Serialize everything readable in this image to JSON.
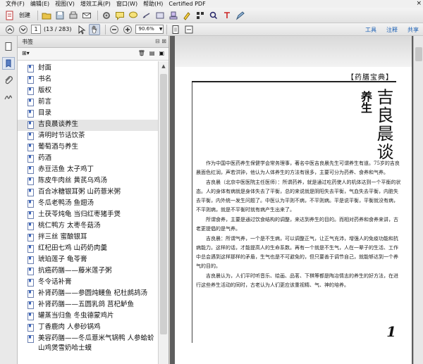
{
  "menu": [
    "文件(F)",
    "编辑(E)",
    "视图(V)",
    "增效工具(P)",
    "窗口(W)",
    "帮助(H)",
    "Certified PDF"
  ],
  "window_control": "×",
  "toolbar1": {
    "create_label": "创建",
    "icons": [
      "create-icon",
      "open-folder-icon",
      "print-icon",
      "save-icon",
      "email-icon",
      "settings-icon",
      "comment-icon",
      "chat-icon",
      "link-icon",
      "tag-icon",
      "stamp-icon",
      "highlight-icon",
      "qr-icon",
      "search-icon",
      "text-icon",
      "edit-icon"
    ]
  },
  "toolbar2": {
    "page_current": "1",
    "page_count": "(13 / 283)",
    "zoom": "90.6%",
    "links": [
      "工具",
      "注释",
      "共享"
    ]
  },
  "bookmarks_panel": {
    "title": "书签",
    "options_label": "⊞▾",
    "items": [
      {
        "label": "封面"
      },
      {
        "label": "书名"
      },
      {
        "label": "版权"
      },
      {
        "label": "前言"
      },
      {
        "label": "目录"
      },
      {
        "label": "吉良晨谈养生",
        "selected": true
      },
      {
        "label": "清明时节话饮茶"
      },
      {
        "label": "葡萄酒与养生"
      },
      {
        "label": "药酒"
      },
      {
        "label": "赤豆活鱼 太子鸡丁"
      },
      {
        "label": "陈皮牛肉丝 黄芪乌鸡汤"
      },
      {
        "label": "百合冰糖银耳粥 山药薏米粥"
      },
      {
        "label": "冬瓜老鸭汤 鱼翅汤"
      },
      {
        "label": "土茯苓炖龟 当归红枣猪手煲"
      },
      {
        "label": "桃仁鸭方 太枣冬菇汤"
      },
      {
        "label": "拌三丝 蜜酿银耳"
      },
      {
        "label": "红杞田七鸡 山药奶肉羹"
      },
      {
        "label": "琥珀莲子 龟苓膏"
      },
      {
        "label": "抗癌药膳——藤米莲子粥"
      },
      {
        "label": "冬令话补膏"
      },
      {
        "label": "补肾药膳——参圆炖鳗鱼 杞杜鹧鸪汤"
      },
      {
        "label": "补肾药膳——五圆乳鸽 莒杞鲈鱼"
      },
      {
        "label": "罐蒸当归鱼 冬虫德蒙鸡片"
      },
      {
        "label": "丁香鹿肉 人参砂锅鸡"
      },
      {
        "label": "美容药膳——冬瓜薏米气锅鸭 人参蛤蚧山鸡煲雪奶哈士蟆"
      }
    ]
  },
  "document": {
    "header_bracket": "【药膳宝典】",
    "title_vertical": "吉良晨谈",
    "subtitle_vertical": "养生",
    "paragraphs": [
      "作为中国中医药养生保健学会常务理事，著名中医吉良晨先生可谓养生有道。75岁的吉良晨面色红润，声若洪钟，他认为人体养生的方法有很多，主要可分为药养、食养和气养。",
      "吉良晨（北京中医医院主任医师）：所谓药养，就是通过吃药使人的机体达到一个平衡的状态。人的身体有病就是身体失去了平衡，总的来说就是阴阳失去平衡，气血失去平衡，内脏失去平衡，内外统一发生问题了。中医认为平则不病，不平则病。平是说平衡，平衡就没有病，不平则病，就是不平衡时就有病产生出来了。",
      "所谓食养，主要是通过饮食结构的调整，来达到养生的目的。而相对药养和食养来讲，古老更提倡的是气养。",
      "吉良晨：所谓气养，一个是不生病，可以调整正气，让正气充沛，增强人的免疫功能和抗病能力。这样的话，才能提高人的生命系数。再有一个就是不生气，人在一辈子的生活、工作中总会遇到这样那样的矛盾，生气也是不可避免的，但只要善于调节自己，就能够达到一个养气的目的。",
      "吉良晨认为，人们平时听音乐、绘画、品茗、下棋等都是陶冶情志的养生的好方法，在进行这些养生活动的同时，古老认为人们更应该重视精、气、神的培养。"
    ],
    "page_number": "1"
  }
}
